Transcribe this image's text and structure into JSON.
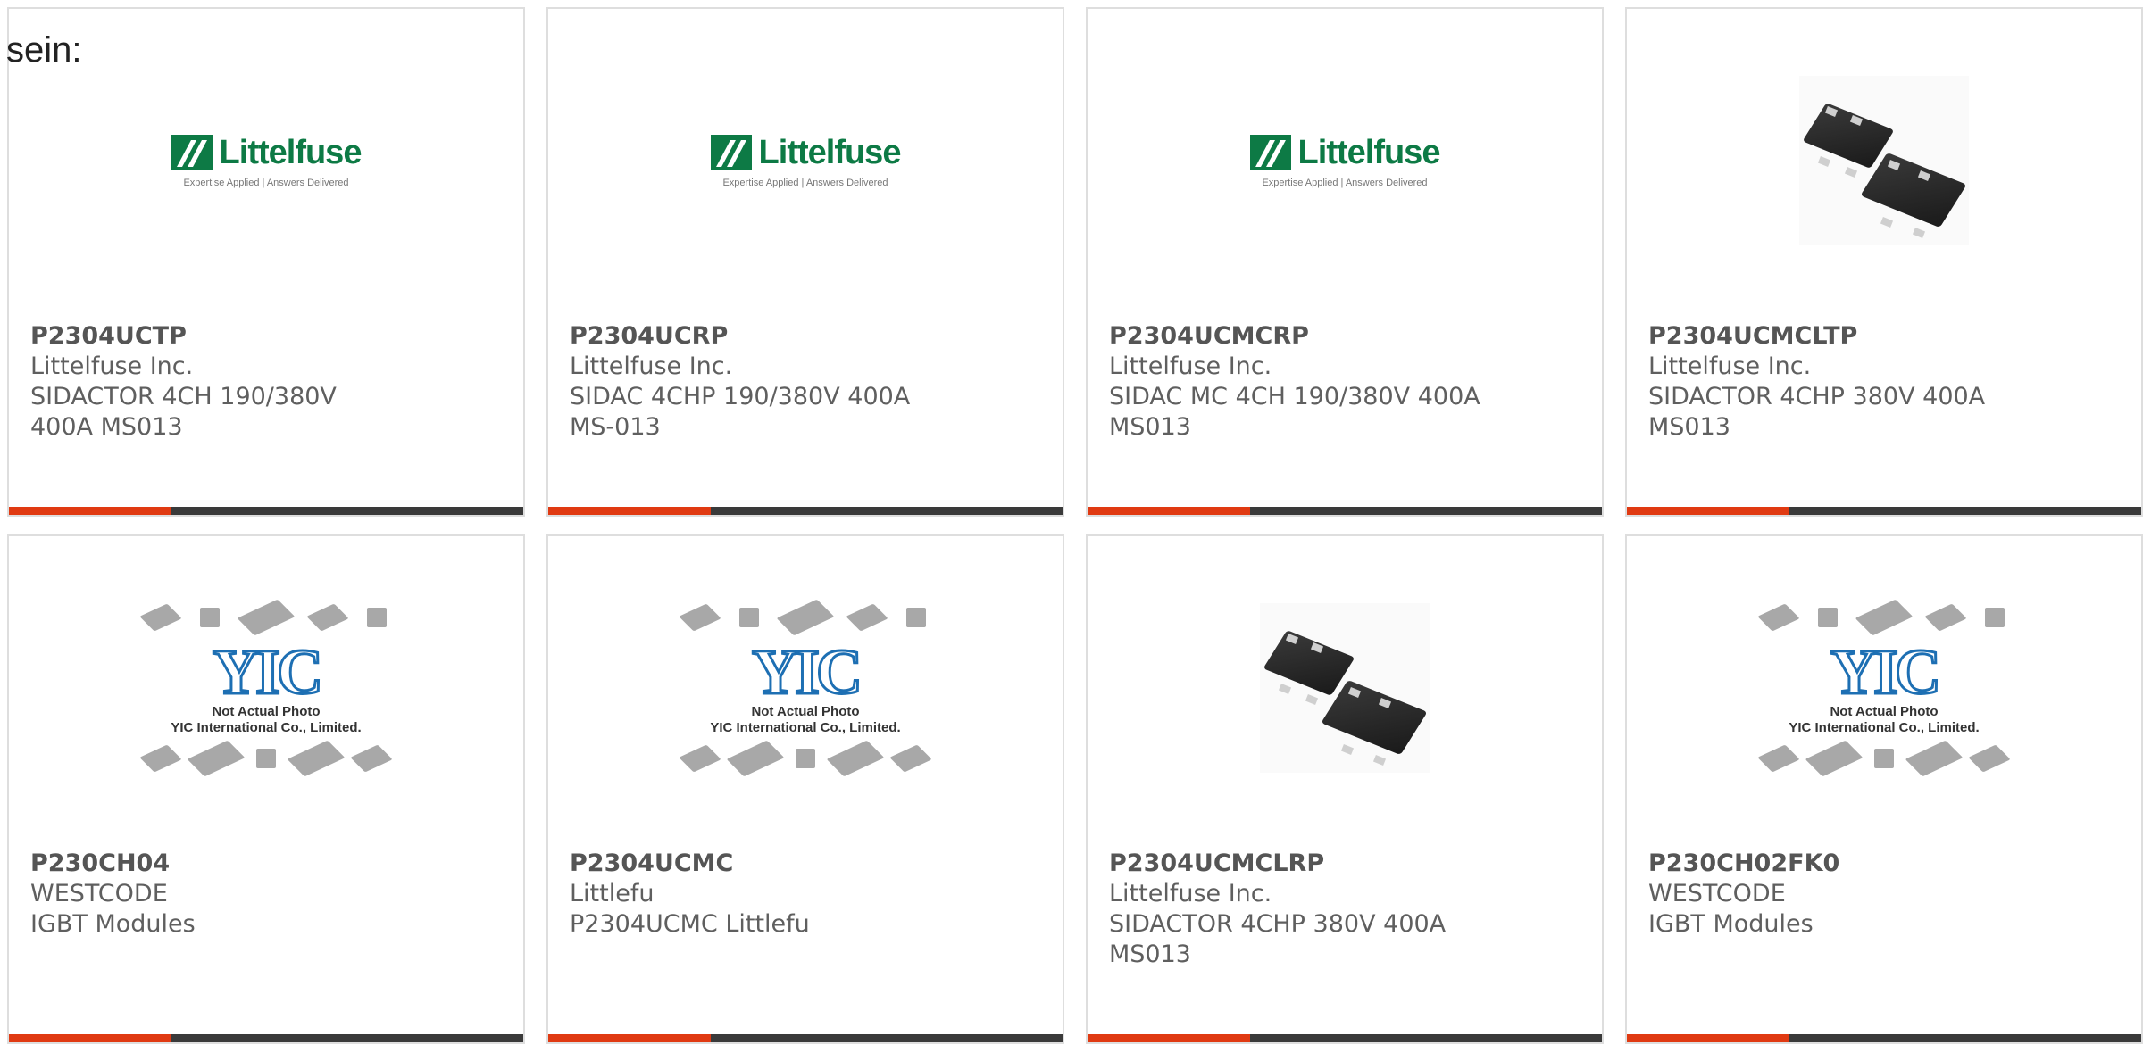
{
  "intro_text": "sein:",
  "products": [
    {
      "part_number": "P2304UCTP",
      "manufacturer": "Littelfuse Inc.",
      "description": "SIDACTOR 4CH 190/380V 400A MS013",
      "image": "littelfuse-logo",
      "image_tag": "Expertise Applied | Answers Delivered"
    },
    {
      "part_number": "P2304UCRP",
      "manufacturer": "Littelfuse Inc.",
      "description": "SIDAC 4CHP 190/380V 400A MS-013",
      "image": "littelfuse-logo",
      "image_tag": "Expertise Applied | Answers Delivered"
    },
    {
      "part_number": "P2304UCMCRP",
      "manufacturer": "Littelfuse Inc.",
      "description": "SIDAC MC 4CH 190/380V 400A MS013",
      "image": "littelfuse-logo",
      "image_tag": "Expertise Applied | Answers Delivered"
    },
    {
      "part_number": "P2304UCMCLTP",
      "manufacturer": "Littelfuse Inc.",
      "description": "SIDACTOR 4CHP 380V 400A MS013",
      "image": "smd-package-photo"
    },
    {
      "part_number": "P230CH04",
      "manufacturer": "WESTCODE",
      "description": "IGBT Modules",
      "image": "yic-placeholder",
      "image_note_1": "Not Actual Photo",
      "image_note_2": "YIC International Co., Limited."
    },
    {
      "part_number": "P2304UCMC",
      "manufacturer": "Littlefu",
      "description": "P2304UCMC Littlefu",
      "image": "yic-placeholder",
      "image_note_1": "Not Actual Photo",
      "image_note_2": "YIC International Co., Limited."
    },
    {
      "part_number": "P2304UCMCLRP",
      "manufacturer": "Littelfuse Inc.",
      "description": "SIDACTOR 4CHP 380V 400A MS013",
      "image": "smd-package-photo"
    },
    {
      "part_number": "P230CH02FK0",
      "manufacturer": "WESTCODE",
      "description": "IGBT Modules",
      "image": "yic-placeholder",
      "image_note_1": "Not Actual Photo",
      "image_note_2": "YIC International Co., Limited."
    }
  ],
  "logo_text": {
    "littelfuse": "Littelfuse",
    "yic": "YIC"
  },
  "colors": {
    "accent": "#e03a12",
    "bar": "#3a3a3a",
    "brand_green": "#0d7a45",
    "yic_blue": "#1d6fb3"
  }
}
